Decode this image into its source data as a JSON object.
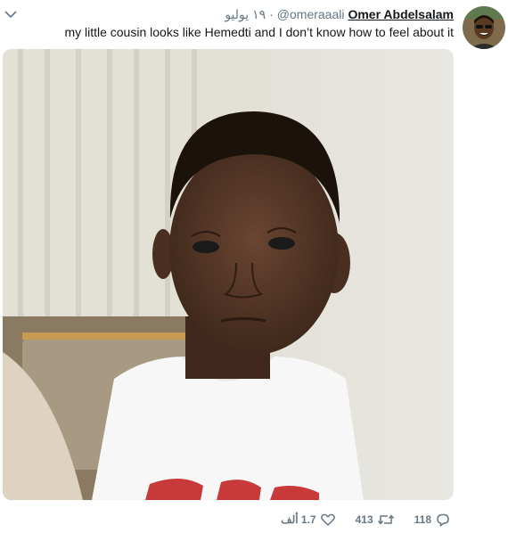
{
  "tweet": {
    "author_name": "Omer Abdelsalam",
    "handle": "@omeraaali",
    "separator": "·",
    "date": "١٩ يوليو",
    "text": "my little cousin looks like Hemedti and I don’t know how to feel about it",
    "replies": "118",
    "retweets": "413",
    "likes": "1.7 ألف"
  },
  "icons": {
    "menu": "chevron-down-icon",
    "reply": "reply-icon",
    "retweet": "retweet-icon",
    "like": "heart-icon"
  },
  "colors": {
    "text": "#14171a",
    "secondary": "#657786",
    "background": "#ffffff"
  }
}
